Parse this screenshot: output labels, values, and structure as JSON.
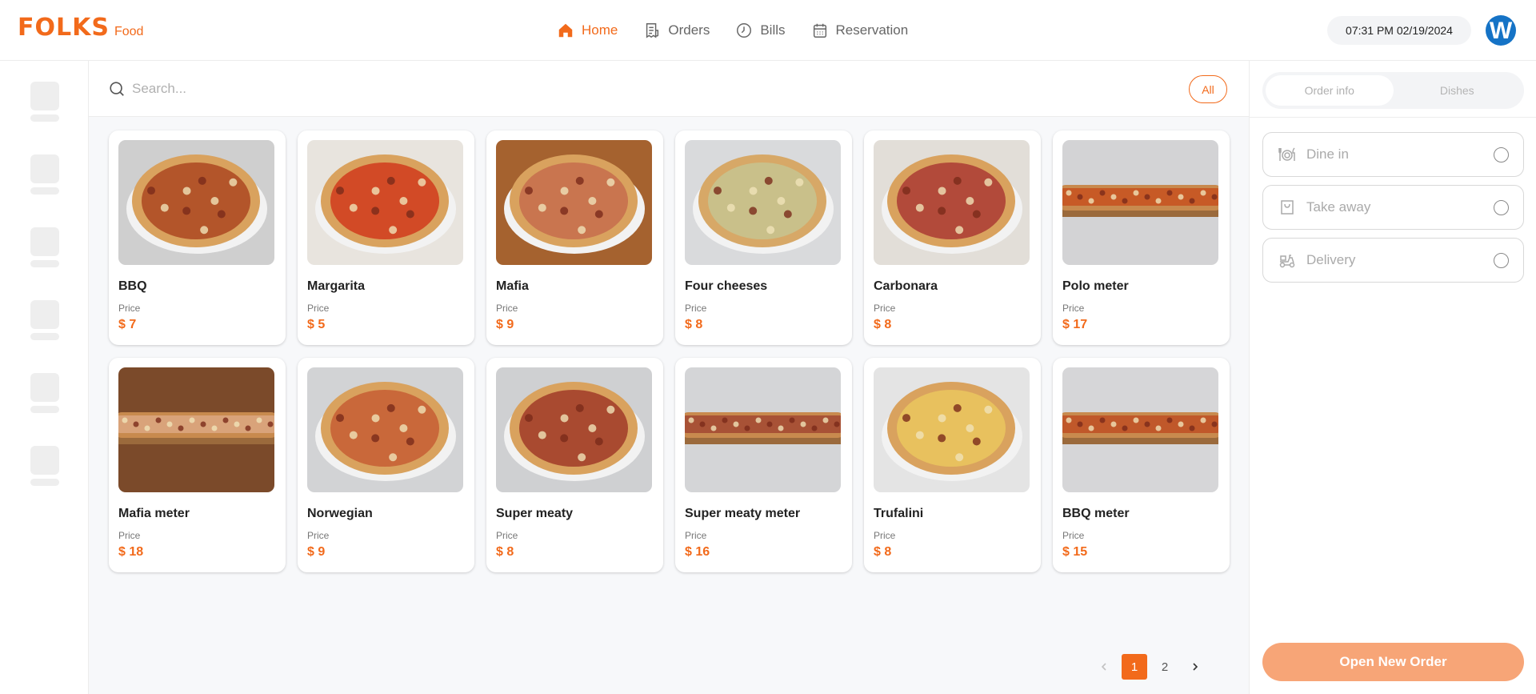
{
  "brand": {
    "logo": "FOLKS",
    "sub": "Food",
    "accent": "#f26a1b"
  },
  "nav": [
    {
      "label": "Home",
      "icon": "home-icon",
      "active": true
    },
    {
      "label": "Orders",
      "icon": "receipt-icon",
      "active": false
    },
    {
      "label": "Bills",
      "icon": "clock-icon",
      "active": false
    },
    {
      "label": "Reservation",
      "icon": "calendar-icon",
      "active": false
    }
  ],
  "datetime": "07:31 PM 02/19/2024",
  "user": {
    "initial": "W",
    "avatar_color": "#1573c6"
  },
  "search": {
    "placeholder": "Search...",
    "value": ""
  },
  "filter": {
    "label": "All"
  },
  "price_label": "Price",
  "dishes": [
    {
      "name": "BBQ",
      "price": "$ 7"
    },
    {
      "name": "Margarita",
      "price": "$ 5"
    },
    {
      "name": "Mafia",
      "price": "$ 9"
    },
    {
      "name": "Four cheeses",
      "price": "$ 8"
    },
    {
      "name": "Carbonara",
      "price": "$ 8"
    },
    {
      "name": "Polo meter",
      "price": "$ 17"
    },
    {
      "name": "Mafia meter",
      "price": "$ 18"
    },
    {
      "name": "Norwegian",
      "price": "$ 9"
    },
    {
      "name": "Super meaty",
      "price": "$ 8"
    },
    {
      "name": "Super meaty meter",
      "price": "$ 16"
    },
    {
      "name": "Trufalini",
      "price": "$ 8"
    },
    {
      "name": "BBQ meter",
      "price": "$ 15"
    }
  ],
  "pagination": {
    "pages": [
      "1",
      "2"
    ],
    "current": "1"
  },
  "panel": {
    "tabs": [
      {
        "label": "Order info",
        "active": true
      },
      {
        "label": "Dishes",
        "active": false
      }
    ],
    "order_types": [
      {
        "label": "Dine in",
        "icon": "dine-in-icon"
      },
      {
        "label": "Take away",
        "icon": "shopping-bag-icon"
      },
      {
        "label": "Delivery",
        "icon": "delivery-icon"
      }
    ],
    "open_button": "Open New Order"
  }
}
